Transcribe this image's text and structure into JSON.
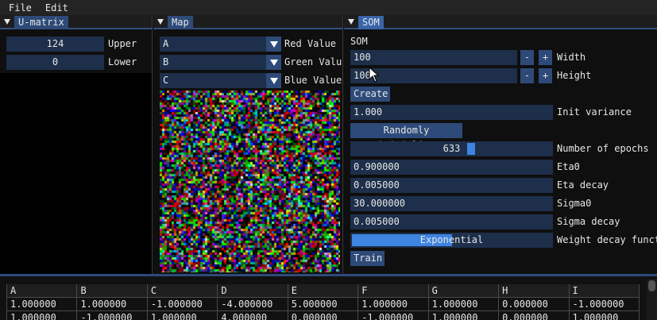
{
  "menu": [
    "File",
    "Edit"
  ],
  "umatrix": {
    "title": "U-matrix",
    "upper_value": "124",
    "upper_label": "Upper",
    "lower_value": "0",
    "lower_label": "Lower"
  },
  "map": {
    "title": "Map",
    "red_value": "A",
    "red_label": "Red Value",
    "green_value": "B",
    "green_label": "Green Value",
    "blue_value": "C",
    "blue_label": "Blue Value"
  },
  "som": {
    "tab": "SOM",
    "section": "SOM",
    "width_value": "100",
    "width_label": "Width",
    "height_value": "100",
    "height_label": "Height",
    "minus": "-",
    "plus": "+",
    "create_label": "Create",
    "init_variance_value": "1.000",
    "init_variance_label": "Init variance",
    "randomly_initialize_label": "Randomly initialize",
    "epochs_value": 633,
    "epochs_fraction": 0.6,
    "epochs_label": "Number of epochs",
    "eta0_value": "0.900000",
    "eta0_label": "Eta0",
    "eta_decay_value": "0.005000",
    "eta_decay_label": "Eta decay",
    "sigma0_value": "30.000000",
    "sigma0_label": "Sigma0",
    "sigma_decay_value": "0.005000",
    "sigma_decay_label": "Sigma decay",
    "weight_decay_value": "Exponential",
    "weight_decay_fraction": 0.5,
    "weight_decay_label": "Weight decay function",
    "train_label": "Train"
  },
  "table": {
    "headers": [
      "A",
      "B",
      "C",
      "D",
      "E",
      "F",
      "G",
      "H",
      "I"
    ],
    "rows": [
      [
        "1.000000",
        "1.000000",
        "-1.000000",
        "-4.000000",
        "5.000000",
        "1.000000",
        "1.000000",
        "0.000000",
        "-1.000000"
      ],
      [
        "1.000000",
        "-1.000000",
        "1.000000",
        "4.000000",
        "0.000000",
        "-1.000000",
        "1.000000",
        "0.000000",
        "1.000000"
      ]
    ]
  },
  "colors": {
    "accent": "#3d85e0",
    "frame": "#1d2f4a",
    "button": "#2d4a78"
  }
}
